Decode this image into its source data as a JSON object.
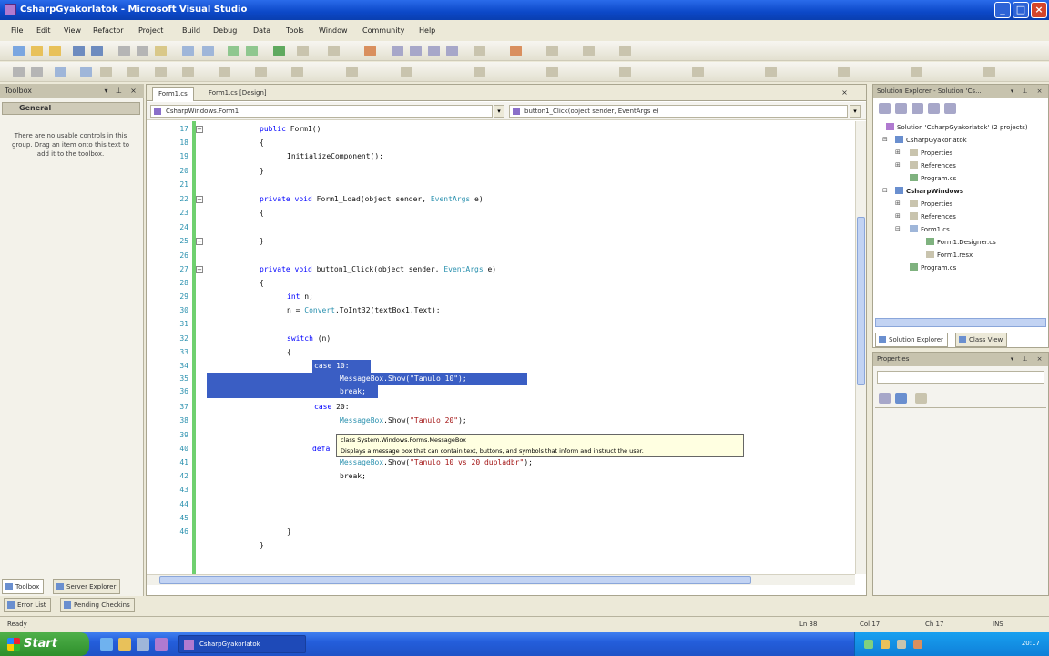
{
  "window": {
    "title": "CsharpGyakorlatok - Microsoft Visual Studio"
  },
  "menu": [
    "File",
    "Edit",
    "View",
    "Refactor",
    "Project",
    "Build",
    "Debug",
    "Data",
    "Tools",
    "Window",
    "Community",
    "Help"
  ],
  "toolbox": {
    "title": "Toolbox",
    "group": "General",
    "message": "There are no usable controls in this group. Drag an item onto this text to add it to the toolbox.",
    "tabs": [
      "Toolbox",
      "Server Explorer"
    ],
    "tabs2": [
      "Error List",
      "Pending Checkins"
    ]
  },
  "editor": {
    "tabs": [
      "Form1.cs",
      "Form1.cs [Design]"
    ],
    "nav_left": "CsharpWindows.Form1",
    "nav_right": "button1_Click(object sender, EventArgs e)",
    "line_numbers": [
      "17",
      "18",
      "19",
      "20",
      "21",
      "22",
      "23",
      "24",
      "25",
      "26",
      "27",
      "28",
      "29",
      "30",
      "31",
      "32",
      "33",
      "34",
      "35",
      "36",
      "37",
      "38",
      "39",
      "40",
      "41",
      "42",
      "43",
      "44",
      "45",
      "46"
    ],
    "code": {
      "l1_kw": "public",
      "l1_rest": " Form1()",
      "l2": "{",
      "l3": "InitializeComponent();",
      "l4": "}",
      "l6_kw1": "private",
      "l6_kw2": " void",
      "l6_rest": " Form1_Load(object sender, ",
      "l6_type": "EventArgs",
      "l6_end": " e)",
      "l7": "{",
      "l9": "}",
      "l11_kw1": "private",
      "l11_kw2": " void",
      "l11_rest": " button1_Click(object sender, ",
      "l11_type": "EventArgs",
      "l11_end": " e)",
      "l12": "{",
      "l13_kw": "int",
      "l13_rest": " n;",
      "l14_pre": "n = ",
      "l14_type": "Convert",
      "l14_rest": ".ToInt32(textBox1.Text);",
      "l16_kw": "switch",
      "l16_rest": " (n)",
      "l17": "{",
      "l18": "case 10:",
      "l19": "MessageBox.Show(\"Tanulo 10\");",
      "l20": "break;",
      "l21_kw": "case",
      "l21_rest": " 20:",
      "l22_type": "MessageBox",
      "l22_rest": ".Show(",
      "l22_str": "\"Tanulo 20\"",
      "l22_end": ");",
      "l24_kw": "defa",
      "l25_type": "MessageBox",
      "l25_rest": ".Show(",
      "l25_str": "\"Tanulo 10 vs 20 dupladbr\"",
      "l25_end": ");",
      "l26": "break;",
      "l29": "}",
      "l30": "}"
    },
    "tooltip": {
      "line1": "class System.Windows.Forms.MessageBox",
      "line2": "Displays a message box that can contain text, buttons, and symbols that inform and instruct the user."
    }
  },
  "solution_explorer": {
    "title": "Solution Explorer - Solution 'Cs...",
    "nodes": [
      "Solution 'CsharpGyakorlatok' (2 projects)",
      "CsharpGyakorlatok",
      "Properties",
      "References",
      "Program.cs",
      "CsharpWindows",
      "Properties",
      "References",
      "Form1.cs",
      "Form1.Designer.cs",
      "Form1.resx",
      "Program.cs"
    ],
    "tabs": [
      "Solution Explorer",
      "Class View"
    ]
  },
  "properties": {
    "title": "Properties"
  },
  "status": {
    "left": "Ready",
    "ln": "Ln 38",
    "col": "Col 17",
    "ch": "Ch 17",
    "mode": "INS"
  },
  "taskbar": {
    "start": "Start",
    "task": "CsharpGyakorlatok",
    "clock": "20:17"
  },
  "colors": {
    "title": "#0c48c8",
    "selection": "#3a5ec4",
    "keyword": "#0000ff",
    "type": "#2b91af",
    "string": "#a31515",
    "gutter": "#6fd06f"
  }
}
